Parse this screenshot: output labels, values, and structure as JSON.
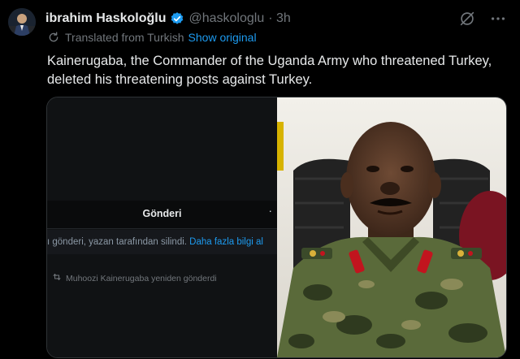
{
  "author": {
    "name": "ibrahim Haskoloğlu",
    "handle": "@haskologlu",
    "time": "· 3h"
  },
  "translation": {
    "label": "Translated from Turkish",
    "link": "Show original"
  },
  "tweet": {
    "text": "Kainerugaba, the Commander of the Uganda Army who threatened Turkey, deleted his threatening posts against Turkey."
  },
  "embedded_screenshot": {
    "title": "Gönderi",
    "menu_dot": "·",
    "deleted_notice": "ı gönderi, yazan tarafından silindi.",
    "more_info_link": "Daha fazla bilgi al",
    "repost_text": "Muhoozi Kainerugaba yeniden gönderdi"
  },
  "colors": {
    "accent": "#1d9bf0",
    "muted": "#71767b",
    "text": "#e7e9ea",
    "background": "#000000"
  },
  "icons": [
    "avatar",
    "verified-badge-icon",
    "grok-icon",
    "more-icon",
    "translate-icon",
    "repost-icon"
  ]
}
